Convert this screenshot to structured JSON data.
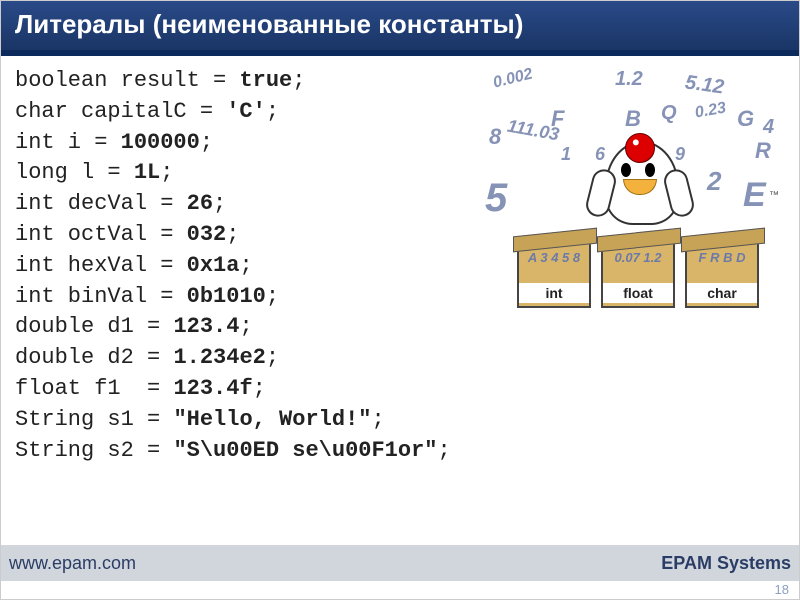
{
  "title": "Литералы (неименованные константы)",
  "code": {
    "l1_t": "boolean result = ",
    "l1_v": "true",
    "l1_e": ";",
    "l2_t": "char capitalC = ",
    "l2_v": "'C'",
    "l2_e": ";",
    "l3_t": "int i = ",
    "l3_v": "100000",
    "l3_e": ";",
    "l4_t": "long l = ",
    "l4_v": "1L",
    "l4_e": ";",
    "l5_t": "int decVal = ",
    "l5_v": "26",
    "l5_e": ";",
    "l6_t": "int octVal = ",
    "l6_v": "032",
    "l6_e": ";",
    "l7_t": "int hexVal = ",
    "l7_v": "0x1a",
    "l7_e": ";",
    "l8_t": "int binVal = ",
    "l8_v": "0b1010",
    "l8_e": ";",
    "l9_t": "double d1 = ",
    "l9_v": "123.4",
    "l9_e": ";",
    "l10_t": "double d2 = ",
    "l10_v": "1.234e2",
    "l10_e": ";",
    "l11_t": "float f1  = ",
    "l11_v": "123.4f",
    "l11_e": ";",
    "l12_t": "String s1 = ",
    "l12_v": "\"Hello, World!\"",
    "l12_e": ";",
    "l13_t": "String s2 = ",
    "l13_v": "\"S\\u00ED se\\u00F1or\"",
    "l13_e": ";"
  },
  "illustration": {
    "boxes": [
      {
        "label": "int",
        "inside": "A 3\n4 5 8"
      },
      {
        "label": "float",
        "inside": "0.07\n1.2"
      },
      {
        "label": "char",
        "inside": "F\nR B D"
      }
    ],
    "floaters": [
      "0.002",
      "1.2",
      "5.12",
      "8",
      "F",
      "111.03",
      "B",
      "Q",
      "0.23",
      "G",
      "4",
      "1",
      "6",
      "9",
      "R",
      "5",
      "2",
      "E"
    ],
    "tm": "™"
  },
  "footer": {
    "url": "www.epam.com",
    "brand": "EPAM Systems",
    "page": "18"
  }
}
